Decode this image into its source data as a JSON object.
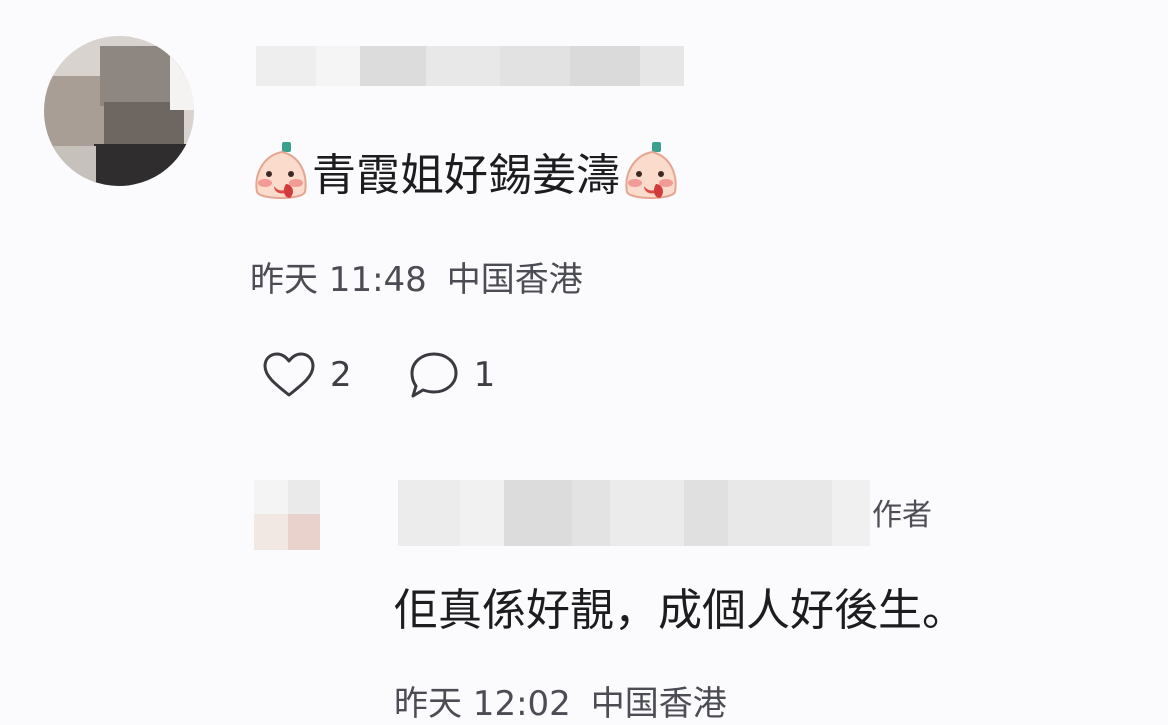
{
  "comment": {
    "text": "青霞姐好錫姜濤",
    "emoji": "blushing-face-emoji",
    "time": "昨天 11:48",
    "location": "中国香港",
    "likes": "2",
    "replies": "1"
  },
  "reply": {
    "author_tag": "作者",
    "text": "佢真係好靚，成個人好後生。",
    "time": "昨天 12:02",
    "location": "中国香港"
  },
  "colors": {
    "background": "#fbfbfd",
    "text": "#1d1d1f",
    "meta": "#4c4c54"
  }
}
